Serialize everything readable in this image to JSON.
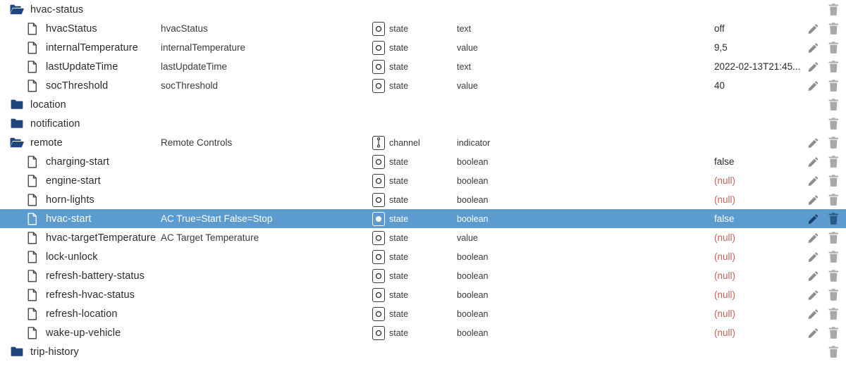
{
  "colors": {
    "selected_row_bg": "#5b9bd0",
    "folder_blue": "#20457c",
    "gear_blue": "#2f6fb5",
    "null_red": "#c0645a",
    "trash_gray": "#a8a8a8",
    "pencil_gray": "#8d8d8d"
  },
  "labels": {
    "kind_state": "state",
    "kind_channel": "channel",
    "type_text": "text",
    "type_value": "value",
    "type_boolean": "boolean",
    "type_indicator": "indicator"
  },
  "rows": [
    {
      "name": "hvac-status",
      "icon": "folder-open-icon",
      "depth": 0,
      "desc": "",
      "kind": "",
      "kind_icon": "",
      "type": "",
      "value": "",
      "value_null": false,
      "selected": false,
      "actions": [
        "trash"
      ]
    },
    {
      "name": "hvacStatus",
      "icon": "document-icon",
      "depth": 1,
      "desc": "hvacStatus",
      "kind": "state",
      "kind_icon": "state-icon",
      "type": "text",
      "value": "off",
      "value_null": false,
      "selected": false,
      "actions": [
        "pencil",
        "trash",
        "gear"
      ]
    },
    {
      "name": "internalTemperature",
      "icon": "document-icon",
      "depth": 1,
      "desc": "internalTemperature",
      "kind": "state",
      "kind_icon": "state-icon",
      "type": "value",
      "value": "9,5",
      "value_null": false,
      "selected": false,
      "actions": [
        "pencil",
        "trash",
        "gear"
      ]
    },
    {
      "name": "lastUpdateTime",
      "icon": "document-icon",
      "depth": 1,
      "desc": "lastUpdateTime",
      "kind": "state",
      "kind_icon": "state-icon",
      "type": "text",
      "value": "2022-02-13T21:45...",
      "value_null": false,
      "selected": false,
      "actions": [
        "pencil",
        "trash",
        "gear"
      ]
    },
    {
      "name": "socThreshold",
      "icon": "document-icon",
      "depth": 1,
      "desc": "socThreshold",
      "kind": "state",
      "kind_icon": "state-icon",
      "type": "value",
      "value": "40",
      "value_null": false,
      "selected": false,
      "actions": [
        "pencil",
        "trash",
        "gear"
      ]
    },
    {
      "name": "location",
      "icon": "folder-closed-icon",
      "depth": 0,
      "desc": "",
      "kind": "",
      "kind_icon": "",
      "type": "",
      "value": "",
      "value_null": false,
      "selected": false,
      "actions": [
        "trash"
      ]
    },
    {
      "name": "notification",
      "icon": "folder-closed-icon",
      "depth": 0,
      "desc": "",
      "kind": "",
      "kind_icon": "",
      "type": "",
      "value": "",
      "value_null": false,
      "selected": false,
      "actions": [
        "trash"
      ]
    },
    {
      "name": "remote",
      "icon": "folder-open-icon",
      "depth": 0,
      "desc": "Remote Controls",
      "kind": "channel",
      "kind_icon": "channel-icon",
      "type": "indicator",
      "value": "",
      "value_null": false,
      "selected": false,
      "actions": [
        "pencil",
        "trash"
      ]
    },
    {
      "name": "charging-start",
      "icon": "document-icon",
      "depth": 1,
      "desc": "",
      "kind": "state",
      "kind_icon": "state-icon",
      "type": "boolean",
      "value": "false",
      "value_null": false,
      "selected": false,
      "actions": [
        "pencil",
        "trash",
        "gear"
      ]
    },
    {
      "name": "engine-start",
      "icon": "document-icon",
      "depth": 1,
      "desc": "",
      "kind": "state",
      "kind_icon": "state-icon",
      "type": "boolean",
      "value": "(null)",
      "value_null": true,
      "selected": false,
      "actions": [
        "pencil",
        "trash",
        "gear"
      ]
    },
    {
      "name": "horn-lights",
      "icon": "document-icon",
      "depth": 1,
      "desc": "",
      "kind": "state",
      "kind_icon": "state-icon",
      "type": "boolean",
      "value": "(null)",
      "value_null": true,
      "selected": false,
      "actions": [
        "pencil",
        "trash",
        "gear"
      ]
    },
    {
      "name": "hvac-start",
      "icon": "document-icon",
      "depth": 1,
      "desc": "AC True=Start False=Stop",
      "kind": "state",
      "kind_icon": "state-icon-filled",
      "type": "boolean",
      "value": "false",
      "value_null": false,
      "selected": true,
      "actions": [
        "pencil",
        "trash",
        "gear"
      ]
    },
    {
      "name": "hvac-targetTemperature",
      "icon": "document-icon",
      "depth": 1,
      "desc": "AC Target Temperature",
      "kind": "state",
      "kind_icon": "state-icon",
      "type": "value",
      "value": "(null)",
      "value_null": true,
      "selected": false,
      "actions": [
        "pencil",
        "trash",
        "gear"
      ]
    },
    {
      "name": "lock-unlock",
      "icon": "document-icon",
      "depth": 1,
      "desc": "",
      "kind": "state",
      "kind_icon": "state-icon",
      "type": "boolean",
      "value": "(null)",
      "value_null": true,
      "selected": false,
      "actions": [
        "pencil",
        "trash",
        "gear"
      ]
    },
    {
      "name": "refresh-battery-status",
      "icon": "document-icon",
      "depth": 1,
      "desc": "",
      "kind": "state",
      "kind_icon": "state-icon",
      "type": "boolean",
      "value": "(null)",
      "value_null": true,
      "selected": false,
      "actions": [
        "pencil",
        "trash",
        "gear"
      ]
    },
    {
      "name": "refresh-hvac-status",
      "icon": "document-icon",
      "depth": 1,
      "desc": "",
      "kind": "state",
      "kind_icon": "state-icon",
      "type": "boolean",
      "value": "(null)",
      "value_null": true,
      "selected": false,
      "actions": [
        "pencil",
        "trash",
        "gear"
      ]
    },
    {
      "name": "refresh-location",
      "icon": "document-icon",
      "depth": 1,
      "desc": "",
      "kind": "state",
      "kind_icon": "state-icon",
      "type": "boolean",
      "value": "(null)",
      "value_null": true,
      "selected": false,
      "actions": [
        "pencil",
        "trash",
        "gear"
      ]
    },
    {
      "name": "wake-up-vehicle",
      "icon": "document-icon",
      "depth": 1,
      "desc": "",
      "kind": "state",
      "kind_icon": "state-icon",
      "type": "boolean",
      "value": "(null)",
      "value_null": true,
      "selected": false,
      "actions": [
        "pencil",
        "trash",
        "gear"
      ]
    },
    {
      "name": "trip-history",
      "icon": "folder-closed-icon",
      "depth": 0,
      "desc": "",
      "kind": "",
      "kind_icon": "",
      "type": "",
      "value": "",
      "value_null": false,
      "selected": false,
      "actions": [
        "trash"
      ]
    }
  ]
}
